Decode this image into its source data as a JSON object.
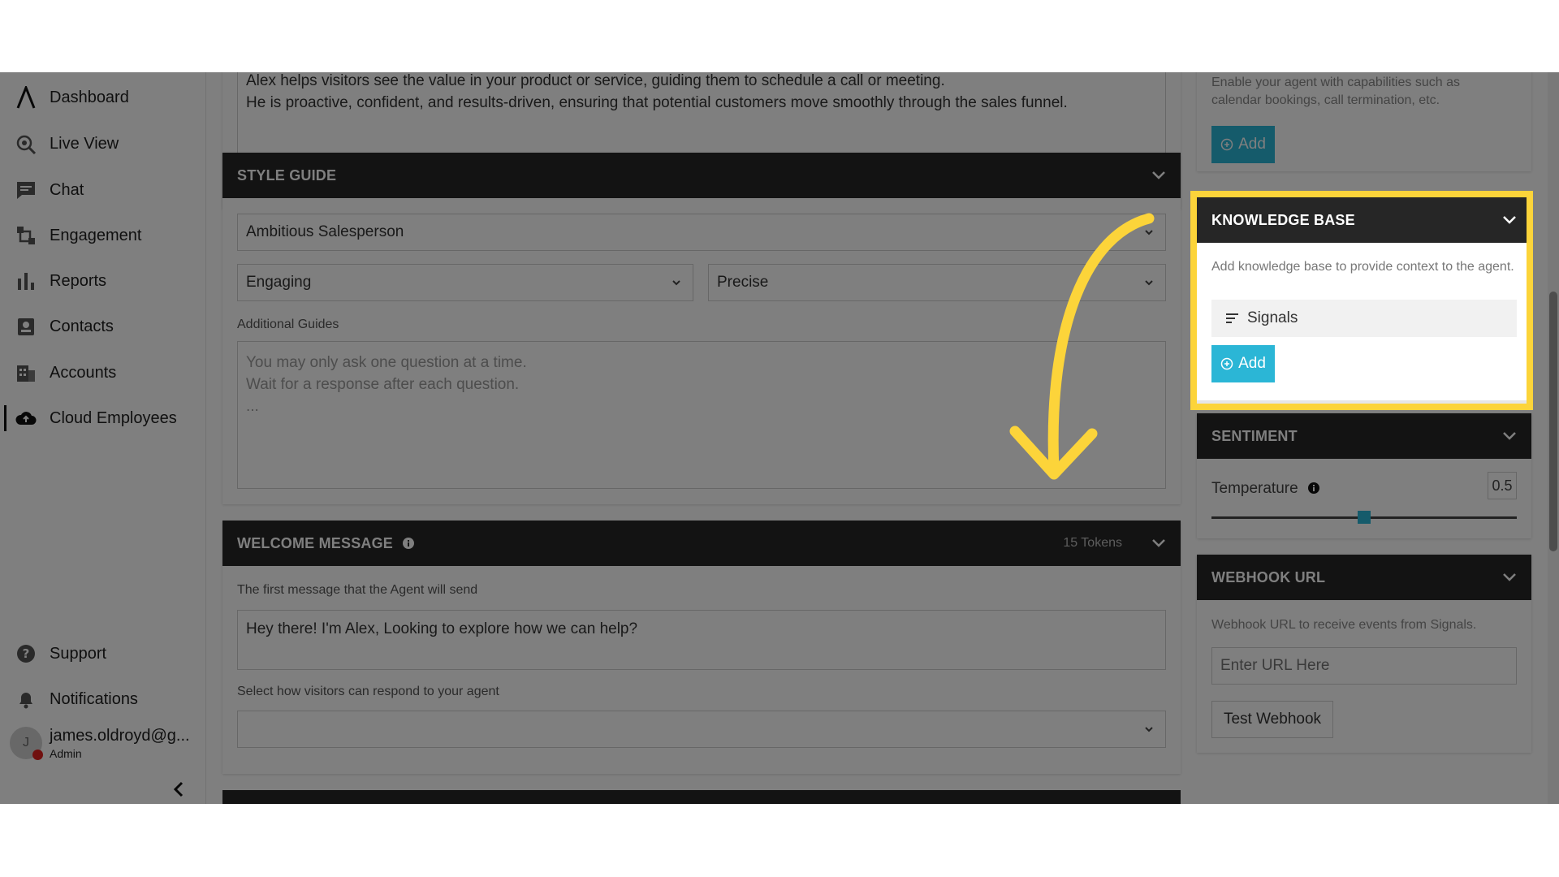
{
  "sidebar": {
    "items": [
      {
        "label": "Dashboard",
        "icon": "logo-icon"
      },
      {
        "label": "Live View",
        "icon": "live-view-icon"
      },
      {
        "label": "Chat",
        "icon": "chat-icon"
      },
      {
        "label": "Engagement",
        "icon": "engagement-icon"
      },
      {
        "label": "Reports",
        "icon": "reports-icon"
      },
      {
        "label": "Contacts",
        "icon": "contacts-icon"
      },
      {
        "label": "Accounts",
        "icon": "accounts-icon"
      },
      {
        "label": "Cloud Employees",
        "icon": "cloud-icon",
        "active": true
      }
    ],
    "bottom_items": [
      {
        "label": "Support",
        "icon": "help-icon"
      },
      {
        "label": "Notifications",
        "icon": "bell-icon"
      }
    ],
    "user": {
      "initial": "J",
      "name": "james.oldroyd@g...",
      "role": "Admin"
    }
  },
  "persona": {
    "line1": "Alex helps visitors see the value in your product or service, guiding them to schedule a call or meeting.",
    "line2": "He is proactive, confident, and results-driven, ensuring that potential customers move smoothly through the sales funnel."
  },
  "style_guide": {
    "title": "STYLE GUIDE",
    "persona_select": "Ambitious Salesperson",
    "tone_select": "Engaging",
    "precision_select": "Precise",
    "additional_label": "Additional Guides",
    "additional_placeholder_1": "You may only ask one question at a time.",
    "additional_placeholder_2": "Wait for a response after each question.",
    "additional_placeholder_3": "..."
  },
  "welcome": {
    "title": "WELCOME MESSAGE",
    "tokens": "15 Tokens",
    "desc": "The first message that the Agent will send",
    "message": "Hey there! I'm Alex, Looking to explore how we can help?",
    "respond_label": "Select how visitors can respond to your agent",
    "respond_value": ""
  },
  "capabilities": {
    "desc": "Enable your agent with capabilities such as calendar bookings, call termination, etc.",
    "add_label": "Add"
  },
  "knowledge_base": {
    "title": "KNOWLEDGE BASE",
    "desc": "Add knowledge base to provide context to the agent.",
    "item": "Signals",
    "add_label": "Add"
  },
  "sentiment": {
    "title": "SENTIMENT",
    "temperature_label": "Temperature",
    "temperature_value": "0.5",
    "slider_fraction": 0.5
  },
  "webhook": {
    "title": "WEBHOOK URL",
    "desc": "Webhook URL to receive events from Signals.",
    "placeholder": "Enter URL Here",
    "test_label": "Test Webhook"
  },
  "colors": {
    "accent": "#2bb6d6",
    "highlight": "#fcd43a",
    "header": "#262626"
  }
}
